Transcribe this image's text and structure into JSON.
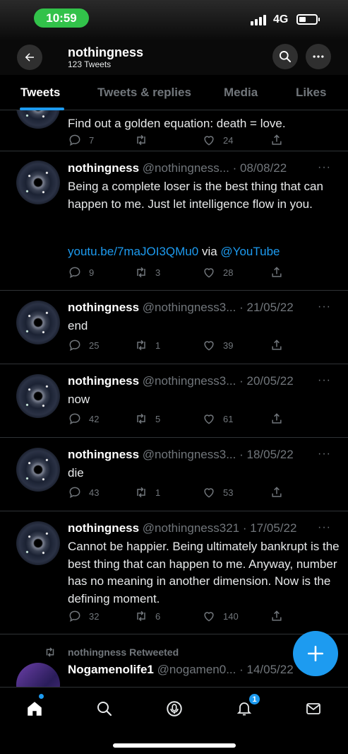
{
  "status_bar": {
    "time": "10:59",
    "network": "4G"
  },
  "header": {
    "title": "nothingness",
    "subtitle": "123 Tweets"
  },
  "tabs": [
    {
      "label": "Tweets",
      "active": true
    },
    {
      "label": "Tweets & replies",
      "active": false
    },
    {
      "label": "Media",
      "active": false
    },
    {
      "label": "Likes",
      "active": false
    }
  ],
  "tweets": [
    {
      "text": "Find out a golden equation: death = love.",
      "replies": "7",
      "retweets": "",
      "likes": "24"
    },
    {
      "name": "nothingness",
      "handle": "@nothingness...",
      "date": "· 08/08/22",
      "text": "Being a complete loser is the best thing that can happen to me. Just let intelligence flow in you.",
      "link": "youtu.be/7maJOI3QMu0",
      "link_via": "via",
      "link_mention": "@YouTube",
      "replies": "9",
      "retweets": "3",
      "likes": "28"
    },
    {
      "name": "nothingness",
      "handle": "@nothingness3...",
      "date": "· 21/05/22",
      "text": "end",
      "replies": "25",
      "retweets": "1",
      "likes": "39"
    },
    {
      "name": "nothingness",
      "handle": "@nothingness3...",
      "date": "· 20/05/22",
      "text": "now",
      "replies": "42",
      "retweets": "5",
      "likes": "61"
    },
    {
      "name": "nothingness",
      "handle": "@nothingness3...",
      "date": "· 18/05/22",
      "text": "die",
      "replies": "43",
      "retweets": "1",
      "likes": "53"
    },
    {
      "name": "nothingness",
      "handle": "@nothingness321",
      "date": "· 17/05/22",
      "text": "Cannot be happier. Being ultimately bankrupt is the best thing that can happen to me. Anyway, number has no meaning in another dimension. Now is the defining moment.",
      "replies": "32",
      "retweets": "6",
      "likes": "140"
    },
    {
      "retweet_label": "nothingness Retweeted",
      "name": "Nogamenolife1",
      "handle": "@nogamen0...",
      "date": "· 14/05/22"
    }
  ],
  "bottom_nav": {
    "notifications_badge": "1"
  },
  "colors": {
    "accent": "#1d9bf0",
    "muted": "#71767b",
    "background": "#000000"
  }
}
